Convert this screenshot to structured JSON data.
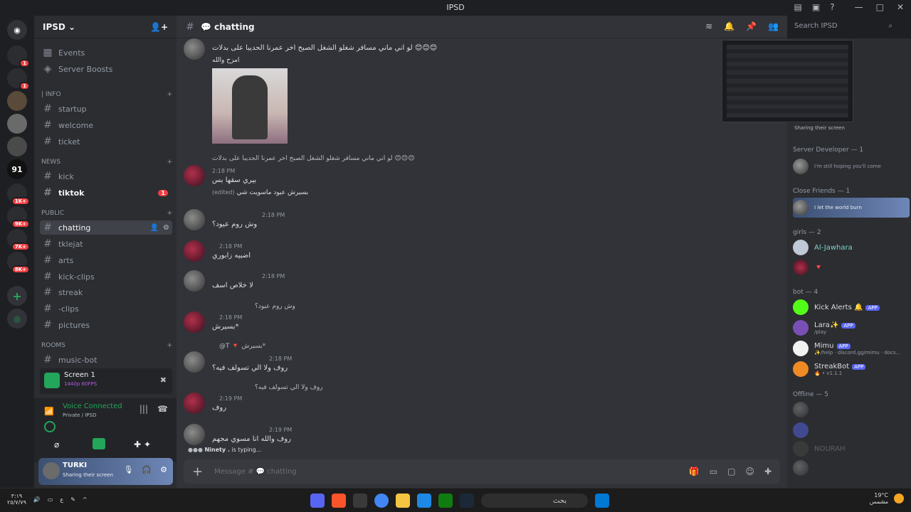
{
  "window": {
    "title": "IPSD"
  },
  "guild": {
    "name": "IPSD"
  },
  "nav": {
    "events": "Events",
    "boosts": "Server Boosts",
    "categories": [
      {
        "label": "| INFO",
        "channels": [
          {
            "label": "startup"
          },
          {
            "label": "welcome"
          },
          {
            "label": "ticket"
          }
        ]
      },
      {
        "label": "NEWS",
        "channels": [
          {
            "label": "kick"
          },
          {
            "label": "tiktok",
            "badge": "1"
          }
        ]
      },
      {
        "label": "PUBLIC",
        "channels": [
          {
            "label": "chatting"
          },
          {
            "label": "tklejat"
          },
          {
            "label": "arts"
          },
          {
            "label": "kick-clips"
          },
          {
            "label": "streak"
          },
          {
            "label": "-clips"
          },
          {
            "label": "pictures"
          }
        ]
      },
      {
        "label": "Rooms",
        "channels": [
          {
            "label": "music-bot"
          }
        ]
      }
    ]
  },
  "screen_panel": {
    "title": "Screen 1",
    "sub": "1440p 60FPS"
  },
  "voice": {
    "status": "Voice Connected",
    "location": "Private / IPSD"
  },
  "user": {
    "name": "TURKI",
    "status": "Sharing their screen"
  },
  "channel": {
    "name": "chatting"
  },
  "search": {
    "placeholder": "Search IPSD"
  },
  "messages": [
    {
      "time": "",
      "text": "لو اني ماني مسافر شغلو الشغل الصبح اخر عمرنا الحديبا على بدلات 😊😊😊",
      "text2": "امزح والله"
    },
    {
      "reply": "لو اني ماني مسافر شغلو الشغل الصبح اخر عمرنا الحديبا على بدلات 😊😊😊",
      "time": "2:18 PM",
      "text": "بيري سقها بس",
      "text2": "بسيرش عيود ماسويت شي",
      "edited": "(edited)"
    },
    {
      "time": "2:18 PM",
      "text": "وش روم عيود؟"
    },
    {
      "time": "2:18 PM",
      "text": "اضبيه زابوري"
    },
    {
      "time": "2:18 PM",
      "text": "لا خلاص اسف"
    },
    {
      "reply": "وش روم عيود؟",
      "time": "2:18 PM",
      "text": "بسيرش*"
    },
    {
      "reply": "@T 🔻 بسيرش*",
      "time": "2:18 PM",
      "text": "روف ولا الي تسولف فيه؟"
    },
    {
      "reply": "روف ولا الي تسولف فيه؟",
      "time": "2:19 PM",
      "text": "روف"
    },
    {
      "time": "2:19 PM",
      "text": "روف والله انا مسوي مجهم"
    }
  ],
  "typing": {
    "name": "Ninety .",
    "suffix": " is typing..."
  },
  "composer": {
    "placeholder": "Message # 💬 chatting"
  },
  "members": {
    "stream_label": "Sharing their screen",
    "groups": [
      {
        "label": "Server Developer — 1",
        "items": [
          {
            "name": "",
            "sub": "I'm still hoping you'll come"
          }
        ]
      },
      {
        "label": "Close Friends — 1",
        "items": [
          {
            "name": "",
            "sub": "I let the world burn"
          }
        ]
      },
      {
        "label": "girls — 2",
        "items": [
          {
            "name": "Al-Jawhara",
            "sub": ""
          },
          {
            "name": "🔻",
            "sub": ""
          }
        ]
      },
      {
        "label": "bot — 4",
        "items": [
          {
            "name": "Kick Alerts 🔔",
            "tag": "APP",
            "sub": ""
          },
          {
            "name": "Lara✨",
            "tag": "APP",
            "sub": "/play"
          },
          {
            "name": "Mimu",
            "tag": "APP",
            "sub": "✨/help · discord.gg/mimu · docs..."
          },
          {
            "name": "StreakBot",
            "tag": "APP",
            "sub": "🔥 • v1.1.1"
          }
        ]
      },
      {
        "label": "Offline — 5",
        "items": [
          {
            "name": ""
          },
          {
            "name": ""
          },
          {
            "name": "NOURAH"
          },
          {
            "name": ""
          }
        ]
      }
    ]
  },
  "taskbar": {
    "search_text": "بحث",
    "clock_time": "٣:١٩",
    "clock_date": "٢٥/٧/٧٩",
    "weather": "19°C",
    "weather_sub": "مشمس",
    "lang": "ع"
  }
}
